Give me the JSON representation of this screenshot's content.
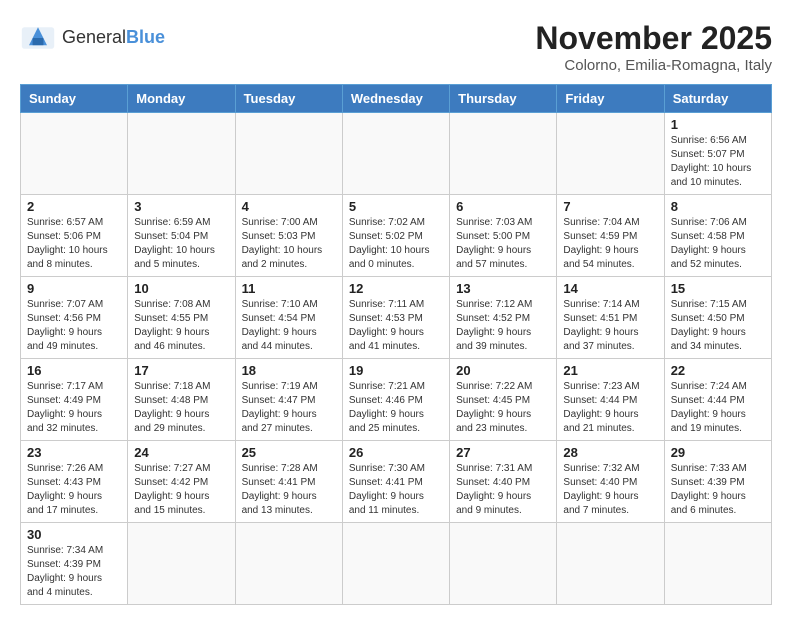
{
  "header": {
    "logo_general": "General",
    "logo_blue": "Blue",
    "month_title": "November 2025",
    "location": "Colorno, Emilia-Romagna, Italy"
  },
  "weekdays": [
    "Sunday",
    "Monday",
    "Tuesday",
    "Wednesday",
    "Thursday",
    "Friday",
    "Saturday"
  ],
  "weeks": [
    [
      {
        "day": "",
        "info": ""
      },
      {
        "day": "",
        "info": ""
      },
      {
        "day": "",
        "info": ""
      },
      {
        "day": "",
        "info": ""
      },
      {
        "day": "",
        "info": ""
      },
      {
        "day": "",
        "info": ""
      },
      {
        "day": "1",
        "info": "Sunrise: 6:56 AM\nSunset: 5:07 PM\nDaylight: 10 hours and 10 minutes."
      }
    ],
    [
      {
        "day": "2",
        "info": "Sunrise: 6:57 AM\nSunset: 5:06 PM\nDaylight: 10 hours and 8 minutes."
      },
      {
        "day": "3",
        "info": "Sunrise: 6:59 AM\nSunset: 5:04 PM\nDaylight: 10 hours and 5 minutes."
      },
      {
        "day": "4",
        "info": "Sunrise: 7:00 AM\nSunset: 5:03 PM\nDaylight: 10 hours and 2 minutes."
      },
      {
        "day": "5",
        "info": "Sunrise: 7:02 AM\nSunset: 5:02 PM\nDaylight: 10 hours and 0 minutes."
      },
      {
        "day": "6",
        "info": "Sunrise: 7:03 AM\nSunset: 5:00 PM\nDaylight: 9 hours and 57 minutes."
      },
      {
        "day": "7",
        "info": "Sunrise: 7:04 AM\nSunset: 4:59 PM\nDaylight: 9 hours and 54 minutes."
      },
      {
        "day": "8",
        "info": "Sunrise: 7:06 AM\nSunset: 4:58 PM\nDaylight: 9 hours and 52 minutes."
      }
    ],
    [
      {
        "day": "9",
        "info": "Sunrise: 7:07 AM\nSunset: 4:56 PM\nDaylight: 9 hours and 49 minutes."
      },
      {
        "day": "10",
        "info": "Sunrise: 7:08 AM\nSunset: 4:55 PM\nDaylight: 9 hours and 46 minutes."
      },
      {
        "day": "11",
        "info": "Sunrise: 7:10 AM\nSunset: 4:54 PM\nDaylight: 9 hours and 44 minutes."
      },
      {
        "day": "12",
        "info": "Sunrise: 7:11 AM\nSunset: 4:53 PM\nDaylight: 9 hours and 41 minutes."
      },
      {
        "day": "13",
        "info": "Sunrise: 7:12 AM\nSunset: 4:52 PM\nDaylight: 9 hours and 39 minutes."
      },
      {
        "day": "14",
        "info": "Sunrise: 7:14 AM\nSunset: 4:51 PM\nDaylight: 9 hours and 37 minutes."
      },
      {
        "day": "15",
        "info": "Sunrise: 7:15 AM\nSunset: 4:50 PM\nDaylight: 9 hours and 34 minutes."
      }
    ],
    [
      {
        "day": "16",
        "info": "Sunrise: 7:17 AM\nSunset: 4:49 PM\nDaylight: 9 hours and 32 minutes."
      },
      {
        "day": "17",
        "info": "Sunrise: 7:18 AM\nSunset: 4:48 PM\nDaylight: 9 hours and 29 minutes."
      },
      {
        "day": "18",
        "info": "Sunrise: 7:19 AM\nSunset: 4:47 PM\nDaylight: 9 hours and 27 minutes."
      },
      {
        "day": "19",
        "info": "Sunrise: 7:21 AM\nSunset: 4:46 PM\nDaylight: 9 hours and 25 minutes."
      },
      {
        "day": "20",
        "info": "Sunrise: 7:22 AM\nSunset: 4:45 PM\nDaylight: 9 hours and 23 minutes."
      },
      {
        "day": "21",
        "info": "Sunrise: 7:23 AM\nSunset: 4:44 PM\nDaylight: 9 hours and 21 minutes."
      },
      {
        "day": "22",
        "info": "Sunrise: 7:24 AM\nSunset: 4:44 PM\nDaylight: 9 hours and 19 minutes."
      }
    ],
    [
      {
        "day": "23",
        "info": "Sunrise: 7:26 AM\nSunset: 4:43 PM\nDaylight: 9 hours and 17 minutes."
      },
      {
        "day": "24",
        "info": "Sunrise: 7:27 AM\nSunset: 4:42 PM\nDaylight: 9 hours and 15 minutes."
      },
      {
        "day": "25",
        "info": "Sunrise: 7:28 AM\nSunset: 4:41 PM\nDaylight: 9 hours and 13 minutes."
      },
      {
        "day": "26",
        "info": "Sunrise: 7:30 AM\nSunset: 4:41 PM\nDaylight: 9 hours and 11 minutes."
      },
      {
        "day": "27",
        "info": "Sunrise: 7:31 AM\nSunset: 4:40 PM\nDaylight: 9 hours and 9 minutes."
      },
      {
        "day": "28",
        "info": "Sunrise: 7:32 AM\nSunset: 4:40 PM\nDaylight: 9 hours and 7 minutes."
      },
      {
        "day": "29",
        "info": "Sunrise: 7:33 AM\nSunset: 4:39 PM\nDaylight: 9 hours and 6 minutes."
      }
    ],
    [
      {
        "day": "30",
        "info": "Sunrise: 7:34 AM\nSunset: 4:39 PM\nDaylight: 9 hours and 4 minutes."
      },
      {
        "day": "",
        "info": ""
      },
      {
        "day": "",
        "info": ""
      },
      {
        "day": "",
        "info": ""
      },
      {
        "day": "",
        "info": ""
      },
      {
        "day": "",
        "info": ""
      },
      {
        "day": "",
        "info": ""
      }
    ]
  ]
}
